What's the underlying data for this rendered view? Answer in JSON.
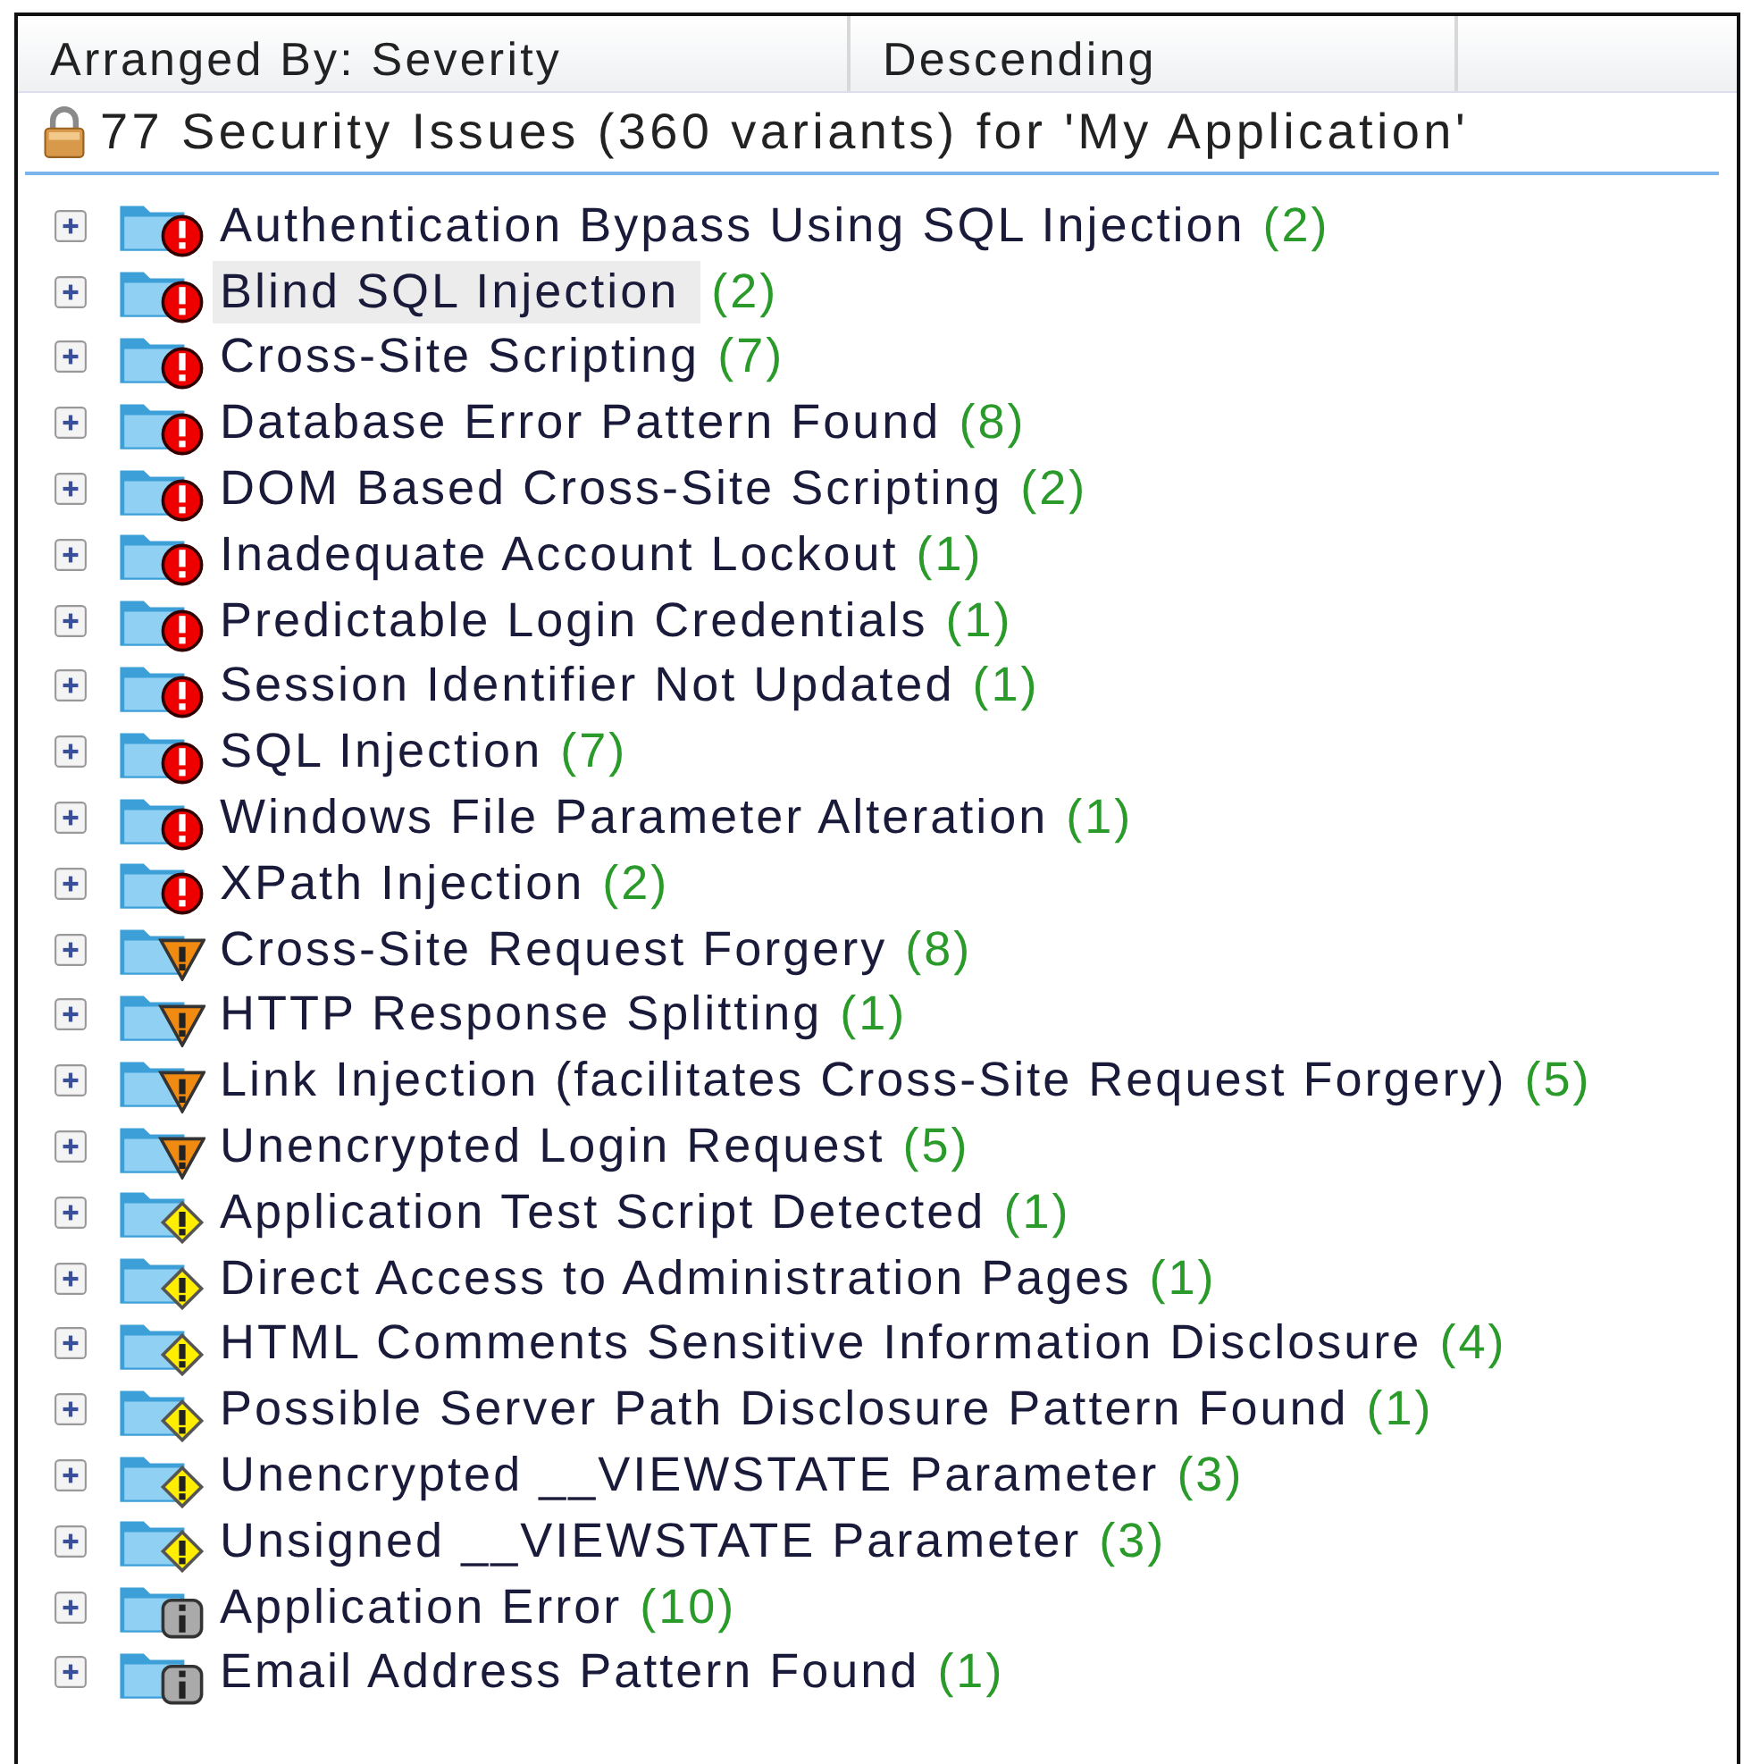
{
  "header": {
    "columns": [
      "Arranged By: Severity",
      "Descending"
    ]
  },
  "summary": "77 Security Issues (360 variants) for 'My Application'",
  "issues": [
    {
      "name": "Authentication Bypass Using SQL Injection",
      "count": "(2)",
      "kind": "high",
      "selected": false,
      "expanded": false
    },
    {
      "name": "Blind SQL Injection",
      "count": "(2)",
      "kind": "high",
      "selected": true,
      "expanded": false
    },
    {
      "name": "Cross-Site Scripting",
      "count": "(7)",
      "kind": "high",
      "selected": false,
      "expanded": false
    },
    {
      "name": "Database Error Pattern Found",
      "count": "(8)",
      "kind": "high",
      "selected": false,
      "expanded": false
    },
    {
      "name": "DOM Based Cross-Site Scripting",
      "count": "(2)",
      "kind": "high",
      "selected": false,
      "expanded": false
    },
    {
      "name": "Inadequate Account Lockout",
      "count": "(1)",
      "kind": "high",
      "selected": false,
      "expanded": false
    },
    {
      "name": "Predictable Login Credentials",
      "count": "(1)",
      "kind": "high",
      "selected": false,
      "expanded": false
    },
    {
      "name": "Session Identifier Not Updated",
      "count": "(1)",
      "kind": "high",
      "selected": false,
      "expanded": false
    },
    {
      "name": "SQL Injection",
      "count": "(7)",
      "kind": "high",
      "selected": false,
      "expanded": false
    },
    {
      "name": "Windows File Parameter Alteration",
      "count": "(1)",
      "kind": "high",
      "selected": false,
      "expanded": false
    },
    {
      "name": "XPath Injection",
      "count": "(2)",
      "kind": "high",
      "selected": false,
      "expanded": false
    },
    {
      "name": "Cross-Site Request Forgery",
      "count": "(8)",
      "kind": "medium",
      "selected": false,
      "expanded": false
    },
    {
      "name": "HTTP Response Splitting",
      "count": "(1)",
      "kind": "medium",
      "selected": false,
      "expanded": false
    },
    {
      "name": "Link Injection (facilitates Cross-Site Request Forgery)",
      "count": "(5)",
      "kind": "medium",
      "selected": false,
      "expanded": false
    },
    {
      "name": "Unencrypted Login Request",
      "count": "(5)",
      "kind": "medium",
      "selected": false,
      "expanded": false
    },
    {
      "name": "Application Test Script Detected",
      "count": "(1)",
      "kind": "low",
      "selected": false,
      "expanded": false
    },
    {
      "name": "Direct Access to Administration Pages",
      "count": "(1)",
      "kind": "low",
      "selected": false,
      "expanded": false
    },
    {
      "name": "HTML Comments Sensitive Information Disclosure",
      "count": "(4)",
      "kind": "low",
      "selected": false,
      "expanded": false
    },
    {
      "name": "Possible Server Path Disclosure Pattern Found",
      "count": "(1)",
      "kind": "low",
      "selected": false,
      "expanded": false
    },
    {
      "name": "Unencrypted __VIEWSTATE Parameter",
      "count": "(3)",
      "kind": "low",
      "selected": false,
      "expanded": false
    },
    {
      "name": "Unsigned __VIEWSTATE Parameter",
      "count": "(3)",
      "kind": "low",
      "selected": false,
      "expanded": false
    },
    {
      "name": "Application Error",
      "count": "(10)",
      "kind": "info",
      "selected": false,
      "expanded": false
    },
    {
      "name": "Email Address Pattern Found",
      "count": "(1)",
      "kind": "info",
      "selected": false,
      "expanded": false
    }
  ]
}
